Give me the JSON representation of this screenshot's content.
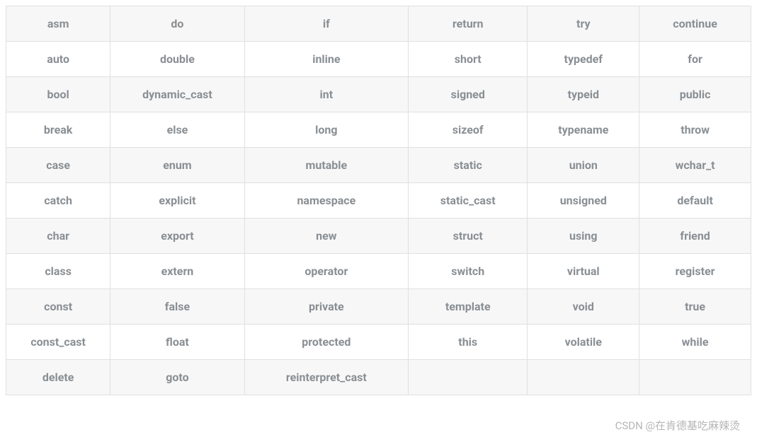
{
  "table": {
    "rows": [
      {
        "cells": [
          "asm",
          "do",
          "if",
          "return",
          "try",
          "continue"
        ]
      },
      {
        "cells": [
          "auto",
          "double",
          "inline",
          "short",
          "typedef",
          "for"
        ]
      },
      {
        "cells": [
          "bool",
          "dynamic_cast",
          "int",
          "signed",
          "typeid",
          "public"
        ]
      },
      {
        "cells": [
          "break",
          "else",
          "long",
          "sizeof",
          "typename",
          "throw"
        ]
      },
      {
        "cells": [
          "case",
          "enum",
          "mutable",
          "static",
          "union",
          "wchar_t"
        ]
      },
      {
        "cells": [
          "catch",
          "explicit",
          "namespace",
          "static_cast",
          "unsigned",
          "default"
        ]
      },
      {
        "cells": [
          "char",
          "export",
          "new",
          "struct",
          "using",
          "friend"
        ]
      },
      {
        "cells": [
          "class",
          "extern",
          "operator",
          "switch",
          "virtual",
          "register"
        ]
      },
      {
        "cells": [
          "const",
          "false",
          "private",
          "template",
          "void",
          "true"
        ]
      },
      {
        "cells": [
          "const_cast",
          "float",
          "protected",
          "this",
          "volatile",
          "while"
        ]
      },
      {
        "cells": [
          "delete",
          "goto",
          "reinterpret_cast",
          "",
          "",
          ""
        ]
      }
    ]
  },
  "watermark": "CSDN @在肯德基吃麻辣烫"
}
